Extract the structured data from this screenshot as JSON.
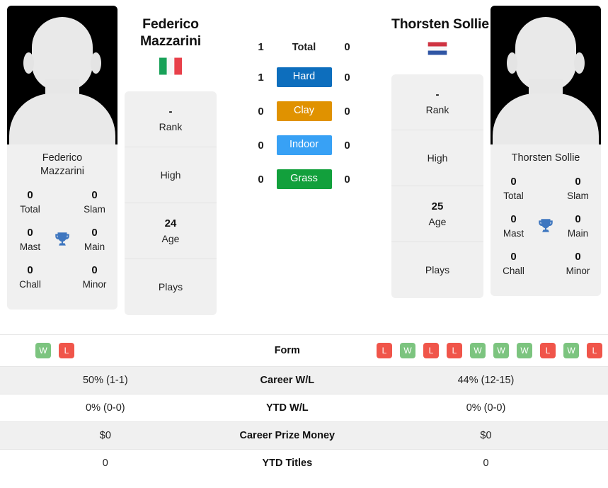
{
  "players": {
    "left": {
      "first_name": "Federico",
      "last_name": "Mazzarini",
      "display_name_line1": "Federico",
      "display_name_line2": "Mazzarini",
      "flag_country": "Italy",
      "flag_icon": "italy-flag-icon",
      "avatar_icon": "player-silhouette-avatar",
      "titles": {
        "total_value": "0",
        "total_label": "Total",
        "slam_value": "0",
        "slam_label": "Slam",
        "mast_value": "0",
        "mast_label": "Mast",
        "main_value": "0",
        "main_label": "Main",
        "chall_value": "0",
        "chall_label": "Chall",
        "minor_value": "0",
        "minor_label": "Minor",
        "trophy_icon": "trophy-icon"
      },
      "info": [
        {
          "value": "-",
          "label": "Rank"
        },
        {
          "value": "",
          "label": "High"
        },
        {
          "value": "24",
          "label": "Age"
        },
        {
          "value": "",
          "label": "Plays"
        }
      ],
      "form": [
        "W",
        "L"
      ]
    },
    "right": {
      "first_name": "Thorsten",
      "last_name": "Sollie",
      "display_name_line1": "Thorsten Sollie",
      "display_name_line2": "",
      "flag_country": "Netherlands",
      "flag_icon": "netherlands-flag-icon",
      "avatar_icon": "player-silhouette-avatar",
      "titles": {
        "total_value": "0",
        "total_label": "Total",
        "slam_value": "0",
        "slam_label": "Slam",
        "mast_value": "0",
        "mast_label": "Mast",
        "main_value": "0",
        "main_label": "Main",
        "chall_value": "0",
        "chall_label": "Chall",
        "minor_value": "0",
        "minor_label": "Minor",
        "trophy_icon": "trophy-icon"
      },
      "info": [
        {
          "value": "-",
          "label": "Rank"
        },
        {
          "value": "",
          "label": "High"
        },
        {
          "value": "25",
          "label": "Age"
        },
        {
          "value": "",
          "label": "Plays"
        }
      ],
      "form": [
        "L",
        "W",
        "L",
        "L",
        "W",
        "W",
        "W",
        "L",
        "W",
        "L"
      ]
    }
  },
  "head_to_head": {
    "total": {
      "label": "Total",
      "left": "1",
      "right": "0"
    },
    "surfaces": [
      {
        "label": "Hard",
        "left": "1",
        "right": "0",
        "color": "#0d6ebd"
      },
      {
        "label": "Clay",
        "left": "0",
        "right": "0",
        "color": "#e09200"
      },
      {
        "label": "Indoor",
        "left": "0",
        "right": "0",
        "color": "#38a1f5"
      },
      {
        "label": "Grass",
        "left": "0",
        "right": "0",
        "color": "#12a03c"
      }
    ]
  },
  "comparison_rows": [
    {
      "label": "Form",
      "left": "",
      "right": "",
      "shaded": false
    },
    {
      "label": "Career W/L",
      "left": "50% (1-1)",
      "right": "44% (12-15)",
      "shaded": true
    },
    {
      "label": "YTD W/L",
      "left": "0% (0-0)",
      "right": "0% (0-0)",
      "shaded": false
    },
    {
      "label": "Career Prize Money",
      "left": "$0",
      "right": "$0",
      "shaded": true
    },
    {
      "label": "YTD Titles",
      "left": "0",
      "right": "0",
      "shaded": false
    }
  ],
  "colors": {
    "win_badge": "#7cc47f",
    "loss_badge": "#f0554a",
    "trophy": "#3e76bf",
    "card_bg": "#f0f0f0"
  }
}
